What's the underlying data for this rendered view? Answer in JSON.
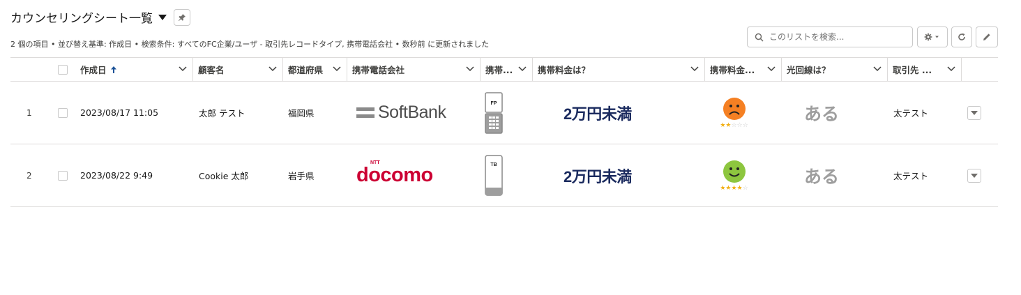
{
  "header": {
    "title": "カウンセリングシート一覧",
    "subtitle": "2 個の項目 • 並び替え基準: 作成日 • 検索条件: すべてのFC企業/ユーザ - 取引先レコードタイプ, 携帯電話会社 • 数秒前 に更新されました"
  },
  "toolbar": {
    "search_placeholder": "このリストを検索..."
  },
  "columns": [
    {
      "label": "作成日",
      "sorted": "asc"
    },
    {
      "label": "顧客名"
    },
    {
      "label": "都道府県"
    },
    {
      "label": "携帯電話会社"
    },
    {
      "label": "携帯..."
    },
    {
      "label": "携帯料金は？"
    },
    {
      "label": "携帯料金..."
    },
    {
      "label": "光回線は？"
    },
    {
      "label": "取引先 ..."
    }
  ],
  "rows": [
    {
      "num": "1",
      "created": "2023/08/17 11:05",
      "customer": "太郎 テスト",
      "prefecture": "福岡県",
      "carrier_logo": "SoftBank",
      "phone_type": "FP",
      "phone_icon": "feature-phone-icon",
      "fee": "2万円未満",
      "satisfaction_icon": "sad-face-icon",
      "satisfaction_color": "#f58023",
      "rating": 2,
      "fiber": "ある",
      "account": "太テスト"
    },
    {
      "num": "2",
      "created": "2023/08/22 9:49",
      "customer": "Cookie 太郎",
      "prefecture": "岩手県",
      "carrier_logo": "docomo",
      "carrier_logo_sub": "NTT",
      "phone_type": "TB",
      "phone_icon": "smartphone-icon",
      "fee": "2万円未満",
      "satisfaction_icon": "happy-face-icon",
      "satisfaction_color": "#8dc63f",
      "rating": 4,
      "fiber": "ある",
      "account": "太テスト"
    }
  ],
  "colors": {
    "docomo_red": "#cc0033",
    "softbank_gray": "#4d4d4d",
    "price_navy": "#1a2a5e",
    "sort_arrow": "#1b5297"
  }
}
